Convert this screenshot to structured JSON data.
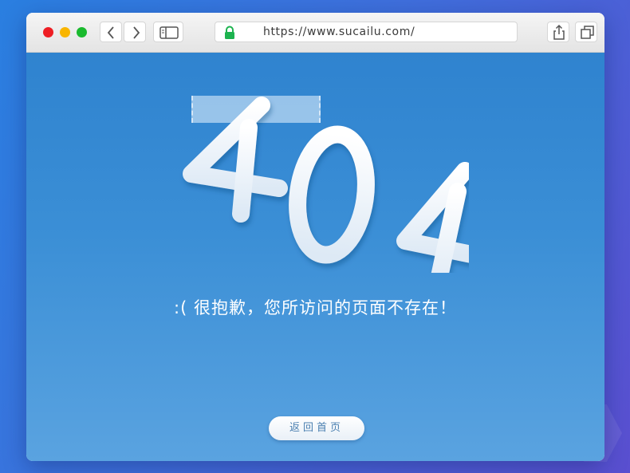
{
  "browser": {
    "url": "https://www.sucailu.com/",
    "traffic_lights": {
      "close": "#ee1e24",
      "minimize": "#f9b500",
      "zoom": "#1aba2e"
    }
  },
  "error_page": {
    "code": "404",
    "message": ":(  很抱歉，您所访问的页面不存在！",
    "home_button_label": "返回首页"
  },
  "colors": {
    "page_background": "#3b8fd6",
    "accent": "#2a7fe0"
  }
}
